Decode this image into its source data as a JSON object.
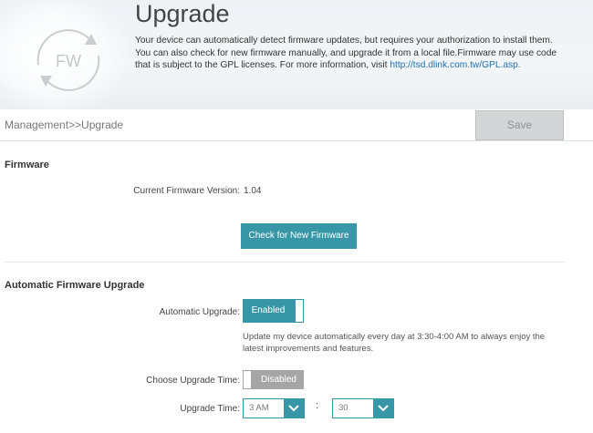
{
  "header": {
    "icon_text": "FW",
    "title": "Upgrade",
    "description": "Your device can automatically detect firmware updates, but requires your authorization to install them. You can also check for new firmware manually, and upgrade it from a local file.Firmware may use code that is subject to the GPL licenses. For more information, visit ",
    "gpl_link": "http://tsd.dlink.com.tw/GPL.asp."
  },
  "toolbar": {
    "breadcrumb": "Management>>Upgrade",
    "save_label": "Save"
  },
  "firmware": {
    "section_title": "Firmware",
    "current_version_label": "Current Firmware Version:",
    "current_version_value": "1.04",
    "check_button_label": "Check for New Firmware"
  },
  "auto_upgrade": {
    "section_title": "Automatic Firmware Upgrade",
    "automatic_upgrade_label": "Automatic Upgrade:",
    "automatic_upgrade_state": "Enabled",
    "note": "Update my device automatically every day at 3:30-4:00 AM to always enjoy the latest improvements and features.",
    "choose_time_label": "Choose Upgrade Time:",
    "choose_time_state": "Disabled",
    "upgrade_time_label": "Upgrade Time:",
    "hour_value": "3 AM",
    "separator": ":",
    "minute_value": "30"
  },
  "colors": {
    "accent": "#3897a6",
    "disabled_toggle": "#a5a5a5",
    "save_button_bg": "#d4d5d6"
  }
}
